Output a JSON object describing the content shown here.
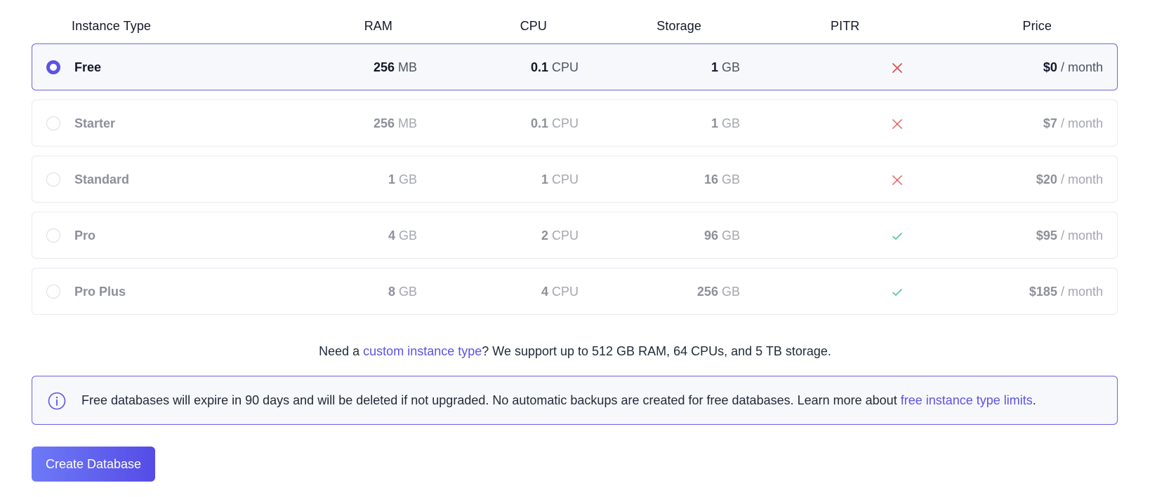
{
  "columns": {
    "instance_type": "Instance Type",
    "ram": "RAM",
    "cpu": "CPU",
    "storage": "Storage",
    "pitr": "PITR",
    "price": "Price"
  },
  "rows": [
    {
      "name": "Free",
      "ram_value": "256",
      "ram_unit": "MB",
      "cpu_value": "0.1",
      "cpu_unit": "CPU",
      "storage_value": "1",
      "storage_unit": "GB",
      "pitr": "x-icon",
      "price_value": "$0",
      "price_unit": "/ month",
      "selected": true
    },
    {
      "name": "Starter",
      "ram_value": "256",
      "ram_unit": "MB",
      "cpu_value": "0.1",
      "cpu_unit": "CPU",
      "storage_value": "1",
      "storage_unit": "GB",
      "pitr": "x-icon",
      "price_value": "$7",
      "price_unit": "/ month",
      "selected": false
    },
    {
      "name": "Standard",
      "ram_value": "1",
      "ram_unit": "GB",
      "cpu_value": "1",
      "cpu_unit": "CPU",
      "storage_value": "16",
      "storage_unit": "GB",
      "pitr": "x-icon",
      "price_value": "$20",
      "price_unit": "/ month",
      "selected": false
    },
    {
      "name": "Pro",
      "ram_value": "4",
      "ram_unit": "GB",
      "cpu_value": "2",
      "cpu_unit": "CPU",
      "storage_value": "96",
      "storage_unit": "GB",
      "pitr": "check-icon",
      "price_value": "$95",
      "price_unit": "/ month",
      "selected": false
    },
    {
      "name": "Pro Plus",
      "ram_value": "8",
      "ram_unit": "GB",
      "cpu_value": "4",
      "cpu_unit": "CPU",
      "storage_value": "256",
      "storage_unit": "GB",
      "pitr": "check-icon",
      "price_value": "$185",
      "price_unit": "/ month",
      "selected": false
    }
  ],
  "custom_note": {
    "prefix": "Need a ",
    "link": "custom instance type",
    "suffix": "? We support up to 512 GB RAM, 64 CPUs, and 5 TB storage."
  },
  "info": {
    "text": "Free databases will expire in 90 days and will be deleted if not upgraded. No automatic backups are created for free databases. Learn more about ",
    "link": "free instance type limits",
    "suffix": "."
  },
  "create_button": "Create Database",
  "colors": {
    "accent": "#5b53e6",
    "x_mark": "#d9534f",
    "check_mark": "#5cc3a8"
  }
}
